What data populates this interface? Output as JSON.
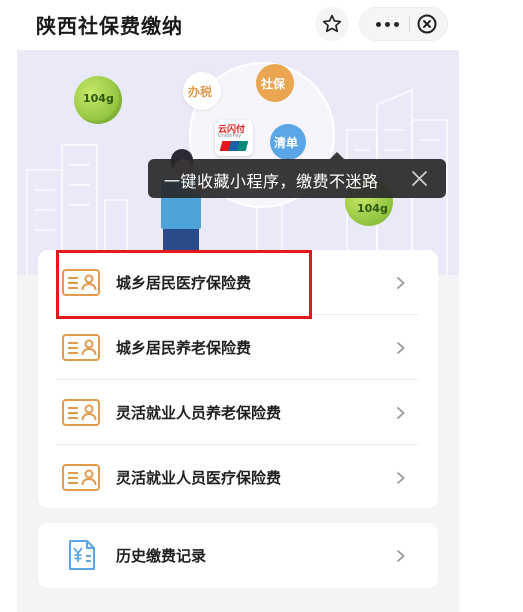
{
  "app": {
    "title": "陕西社保费缴纳"
  },
  "colors": {
    "accent_orange": "#e29a4d",
    "accent_blue": "#5aa6e6",
    "banner_bg": "#e9e9f7",
    "highlight_red": "#e5191b",
    "tooltip_bg": "#28282a"
  },
  "banner": {
    "bubbles": [
      {
        "label": "办税"
      },
      {
        "label": "社保"
      },
      {
        "label": "清单"
      }
    ],
    "badges": [
      "104g",
      "104g"
    ],
    "phone_app": {
      "brand": "云闪付",
      "sub": "UnionPay"
    }
  },
  "tooltip": {
    "text": "一键收藏小程序，缴费不迷路"
  },
  "menu": {
    "items": [
      {
        "label": "城乡居民医疗保险费",
        "icon": "id-card-icon"
      },
      {
        "label": "城乡居民养老保险费",
        "icon": "id-card-icon"
      },
      {
        "label": "灵活就业人员养老保险费",
        "icon": "id-card-icon"
      },
      {
        "label": "灵活就业人员医疗保险费",
        "icon": "id-card-icon"
      }
    ]
  },
  "history": {
    "label": "历史缴费记录",
    "icon": "payment-record-icon"
  }
}
